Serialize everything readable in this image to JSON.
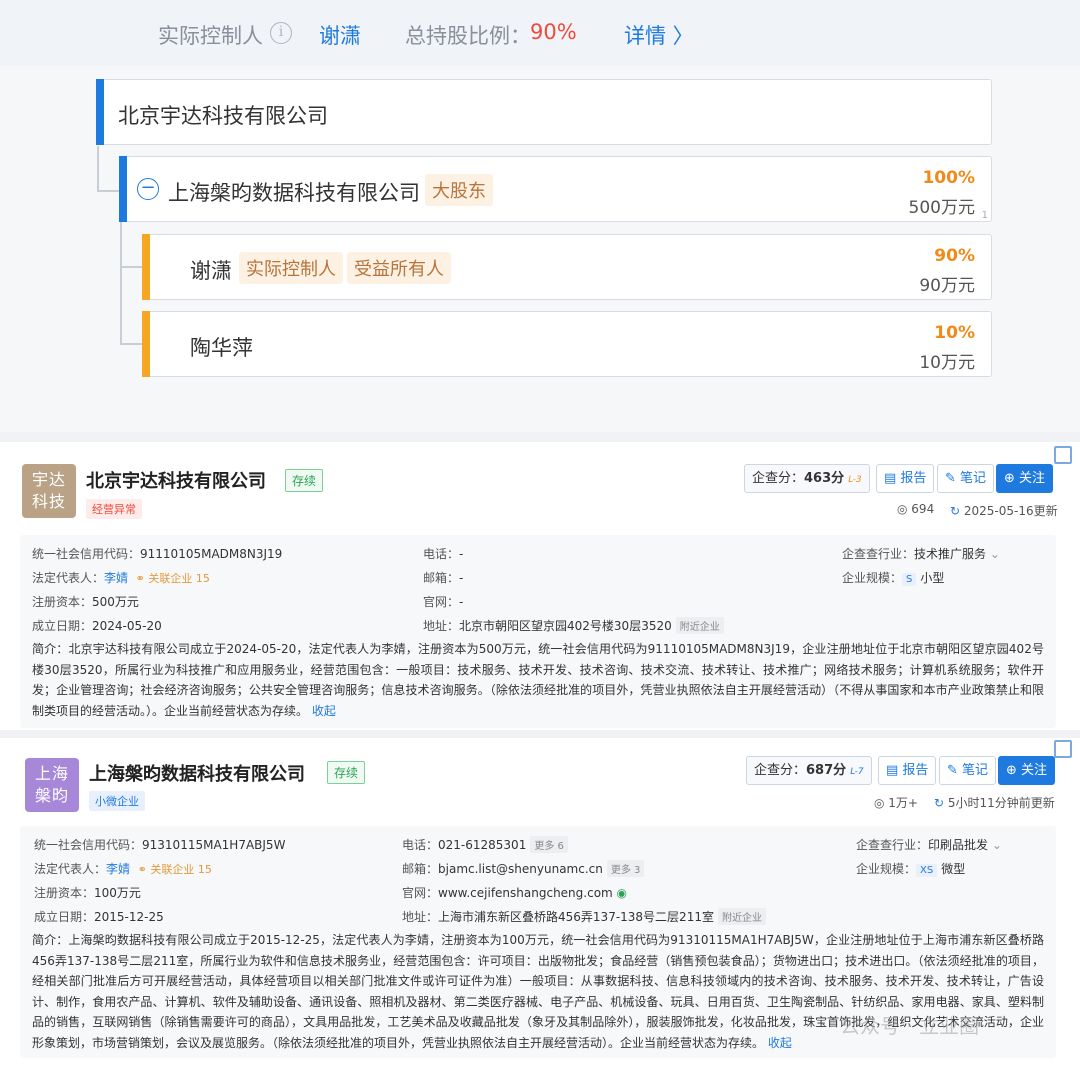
{
  "controller_bar": {
    "label": "实际控制人",
    "name": "谢潇",
    "ratio_label": "总持股比例：",
    "ratio_value": "90%",
    "details": "详情 〉"
  },
  "tree": {
    "root": "北京宇达科技有限公司",
    "shareholder": {
      "name": "上海槃昀数据科技有限公司",
      "tag": "大股东",
      "pct": "100%",
      "amount": "500万元",
      "count": "1"
    },
    "children": [
      {
        "name": "谢潇",
        "tags": [
          "实际控制人",
          "受益所有人"
        ],
        "pct": "90%",
        "amount": "90万元"
      },
      {
        "name": "陶华萍",
        "tags": [],
        "pct": "10%",
        "amount": "10万元"
      }
    ]
  },
  "companies": [
    {
      "logo": [
        "宇达",
        "科技"
      ],
      "logo_color": "#b9a286",
      "name": "北京宇达科技有限公司",
      "status": "存续",
      "badge": "经营异常",
      "score_label": "企查分：",
      "score": "463分",
      "level": "L-3",
      "report": "报告",
      "note": "笔记",
      "follow": "关注",
      "views": "694",
      "updated": "2025-05-16更新",
      "credit_label": "统一社会信用代码：",
      "credit": "91110105MADM8N3J19",
      "legal_label": "法定代表人：",
      "legal": "李婧",
      "related": "关联企业",
      "related_count": "15",
      "capital_label": "注册资本：",
      "capital": "500万元",
      "date_label": "成立日期：",
      "date": "2024-05-20",
      "phone_label": "电话：",
      "phone": "-",
      "phone_more": "",
      "email_label": "邮箱：",
      "email": "-",
      "email_more": "",
      "site_label": "官网：",
      "site": "-",
      "addr_label": "地址：",
      "addr": "北京市朝阳区望京园402号楼30层3520",
      "nearby": "附近企业",
      "industry_label": "企查查行业：",
      "industry": "技术推广服务",
      "scale_label": "企业规模：",
      "scale_tag": "S",
      "scale": "小型",
      "intro_label": "简介：",
      "intro": "北京宇达科技有限公司成立于2024-05-20，法定代表人为李婧，注册资本为500万元，统一社会信用代码为91110105MADM8N3J19，企业注册地址位于北京市朝阳区望京园402号楼30层3520，所属行业为科技推广和应用服务业，经营范围包含：一般项目：技术服务、技术开发、技术咨询、技术交流、技术转让、技术推广；网络技术服务；计算机系统服务；软件开发；企业管理咨询；社会经济咨询服务；公共安全管理咨询服务；信息技术咨询服务。（除依法须经批准的项目外，凭营业执照依法自主开展经营活动）（不得从事国家和本市产业政策禁止和限制类项目的经营活动。）。企业当前经营状态为存续。",
      "collapse": "收起"
    },
    {
      "logo": [
        "上海",
        "槃昀"
      ],
      "logo_color": "#a687d8",
      "name": "上海槃昀数据科技有限公司",
      "status": "存续",
      "badge": "小微企业",
      "score_label": "企查分：",
      "score": "687分",
      "level": "L-7",
      "report": "报告",
      "note": "笔记",
      "follow": "关注",
      "views": "1万+",
      "updated": "5小时11分钟前更新",
      "credit_label": "统一社会信用代码：",
      "credit": "91310115MA1H7ABJ5W",
      "legal_label": "法定代表人：",
      "legal": "李婧",
      "related": "关联企业",
      "related_count": "15",
      "capital_label": "注册资本：",
      "capital": "100万元",
      "date_label": "成立日期：",
      "date": "2015-12-25",
      "phone_label": "电话：",
      "phone": "021-61285301",
      "phone_more": "更多 6",
      "email_label": "邮箱：",
      "email": "bjamc.list@shenyunamc.cn",
      "email_more": "更多 3",
      "site_label": "官网：",
      "site": "www.cejifenshangcheng.com",
      "addr_label": "地址：",
      "addr": "上海市浦东新区叠桥路456弄137-138号二层211室",
      "nearby": "附近企业",
      "industry_label": "企查查行业：",
      "industry": "印刷品批发",
      "scale_label": "企业规模：",
      "scale_tag": "XS",
      "scale": "微型",
      "intro_label": "简介：",
      "intro": "上海槃昀数据科技有限公司成立于2015-12-25，法定代表人为李婧，注册资本为100万元，统一社会信用代码为91310115MA1H7ABJ5W，企业注册地址位于上海市浦东新区叠桥路456弄137-138号二层211室，所属行业为软件和信息技术服务业，经营范围包含：许可项目：出版物批发；食品经营（销售预包装食品）；货物进出口；技术进出口。（依法须经批准的项目，经相关部门批准后方可开展经营活动，具体经营项目以相关部门批准文件或许可证件为准）一般项目：从事数据科技、信息科技领域内的技术咨询、技术服务、技术开发、技术转让，广告设计、制作，食用农产品、计算机、软件及辅助设备、通讯设备、照相机及器材、第二类医疗器械、电子产品、机械设备、玩具、日用百货、卫生陶瓷制品、针纺织品、家用电器、家具、塑料制品的销售，互联网销售（除销售需要许可的商品），文具用品批发，工艺美术品及收藏品批发（象牙及其制品除外），服装服饰批发，化妆品批发，珠宝首饰批发，组织文化艺术交流活动，企业形象策划，市场营销策划，会议及展览服务。（除依法须经批准的项目外，凭营业执照依法自主开展经营活动）。企业当前经营状态为存续。",
      "collapse": "收起"
    }
  ],
  "watermark": "公众号 · 立业圈"
}
